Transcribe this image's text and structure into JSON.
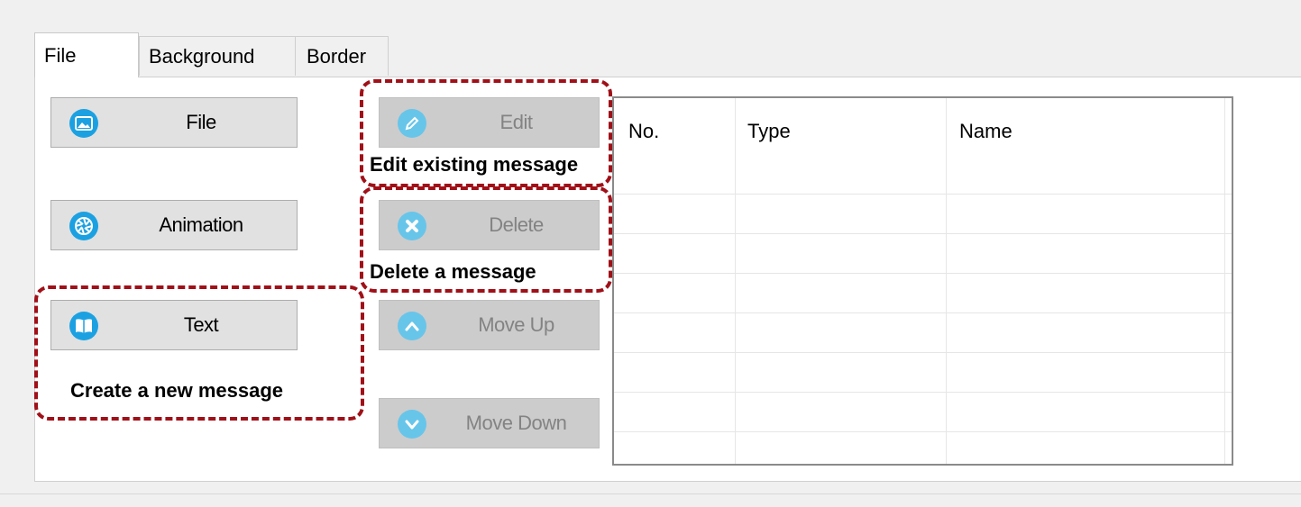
{
  "tabs": [
    "File",
    "Background",
    "Border"
  ],
  "buttons": {
    "file": "File",
    "animation": "Animation",
    "text": "Text",
    "edit": "Edit",
    "delete": "Delete",
    "move_up": "Move Up",
    "move_down": "Move Down"
  },
  "annotations": {
    "edit": "Edit existing message",
    "delete": "Delete a message",
    "create": "Create a new message"
  },
  "list": {
    "columns": [
      "No.",
      "Type",
      "Name"
    ],
    "rows": []
  },
  "colors": {
    "icon_active": "#1ba1e2",
    "icon_disabled": "#67c5ea",
    "annotation": "#a01018"
  }
}
